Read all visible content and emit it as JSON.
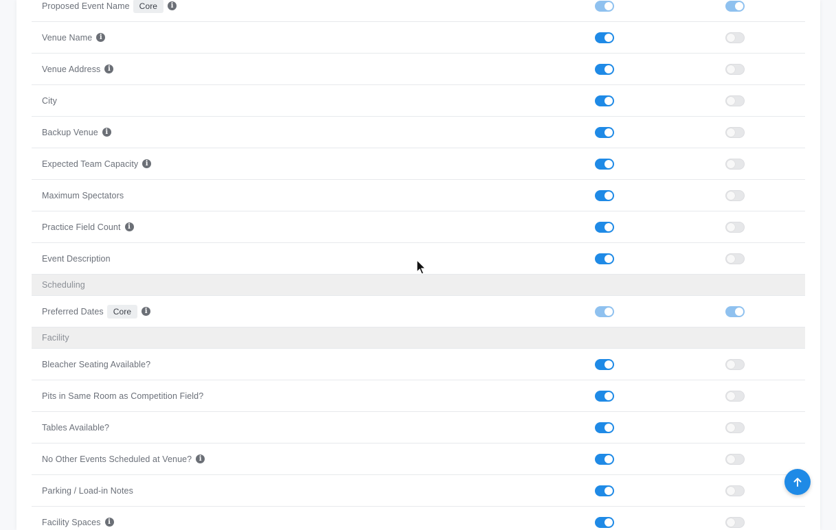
{
  "badge_core": "Core",
  "rows": [
    {
      "label": "Proposed Event Name",
      "core": true,
      "info": true,
      "toggle_a": "disabled",
      "toggle_b": "disabled"
    },
    {
      "label": "Venue Name",
      "info": true,
      "toggle_a": "on",
      "toggle_b": "off"
    },
    {
      "label": "Venue Address",
      "info": true,
      "toggle_a": "on",
      "toggle_b": "off"
    },
    {
      "label": "City",
      "toggle_a": "on",
      "toggle_b": "off"
    },
    {
      "label": "Backup Venue",
      "info": true,
      "toggle_a": "on",
      "toggle_b": "off"
    },
    {
      "label": "Expected Team Capacity",
      "info": true,
      "toggle_a": "on",
      "toggle_b": "off"
    },
    {
      "label": "Maximum Spectators",
      "toggle_a": "on",
      "toggle_b": "off"
    },
    {
      "label": "Practice Field Count",
      "info": true,
      "toggle_a": "on",
      "toggle_b": "off"
    },
    {
      "label": "Event Description",
      "toggle_a": "on",
      "toggle_b": "off"
    }
  ],
  "section_scheduling": "Scheduling",
  "row_preferred_dates": {
    "label": "Preferred Dates",
    "core": true,
    "info": true,
    "toggle_a": "disabled",
    "toggle_b": "disabled"
  },
  "section_facility": "Facility",
  "facility_rows": [
    {
      "label": "Bleacher Seating Available?",
      "toggle_a": "on",
      "toggle_b": "off"
    },
    {
      "label": "Pits in Same Room as Competition Field?",
      "toggle_a": "on",
      "toggle_b": "off"
    },
    {
      "label": "Tables Available?",
      "toggle_a": "on",
      "toggle_b": "off"
    },
    {
      "label": "No Other Events Scheduled at Venue?",
      "info": true,
      "toggle_a": "on",
      "toggle_b": "off"
    },
    {
      "label": "Parking / Load-in Notes",
      "toggle_a": "on",
      "toggle_b": "off"
    },
    {
      "label": "Facility Spaces",
      "info": true,
      "toggle_a": "on",
      "toggle_b": "off"
    }
  ],
  "colors": {
    "toggle_on": "#1f8ae6",
    "toggle_disabled": "#8fc1ef",
    "toggle_off": "#e6e7e9",
    "section_bg": "#efefef"
  },
  "icons": {
    "info": "info-circle-icon",
    "scroll_top": "arrow-up-icon",
    "cursor": "mouse-pointer-icon"
  }
}
